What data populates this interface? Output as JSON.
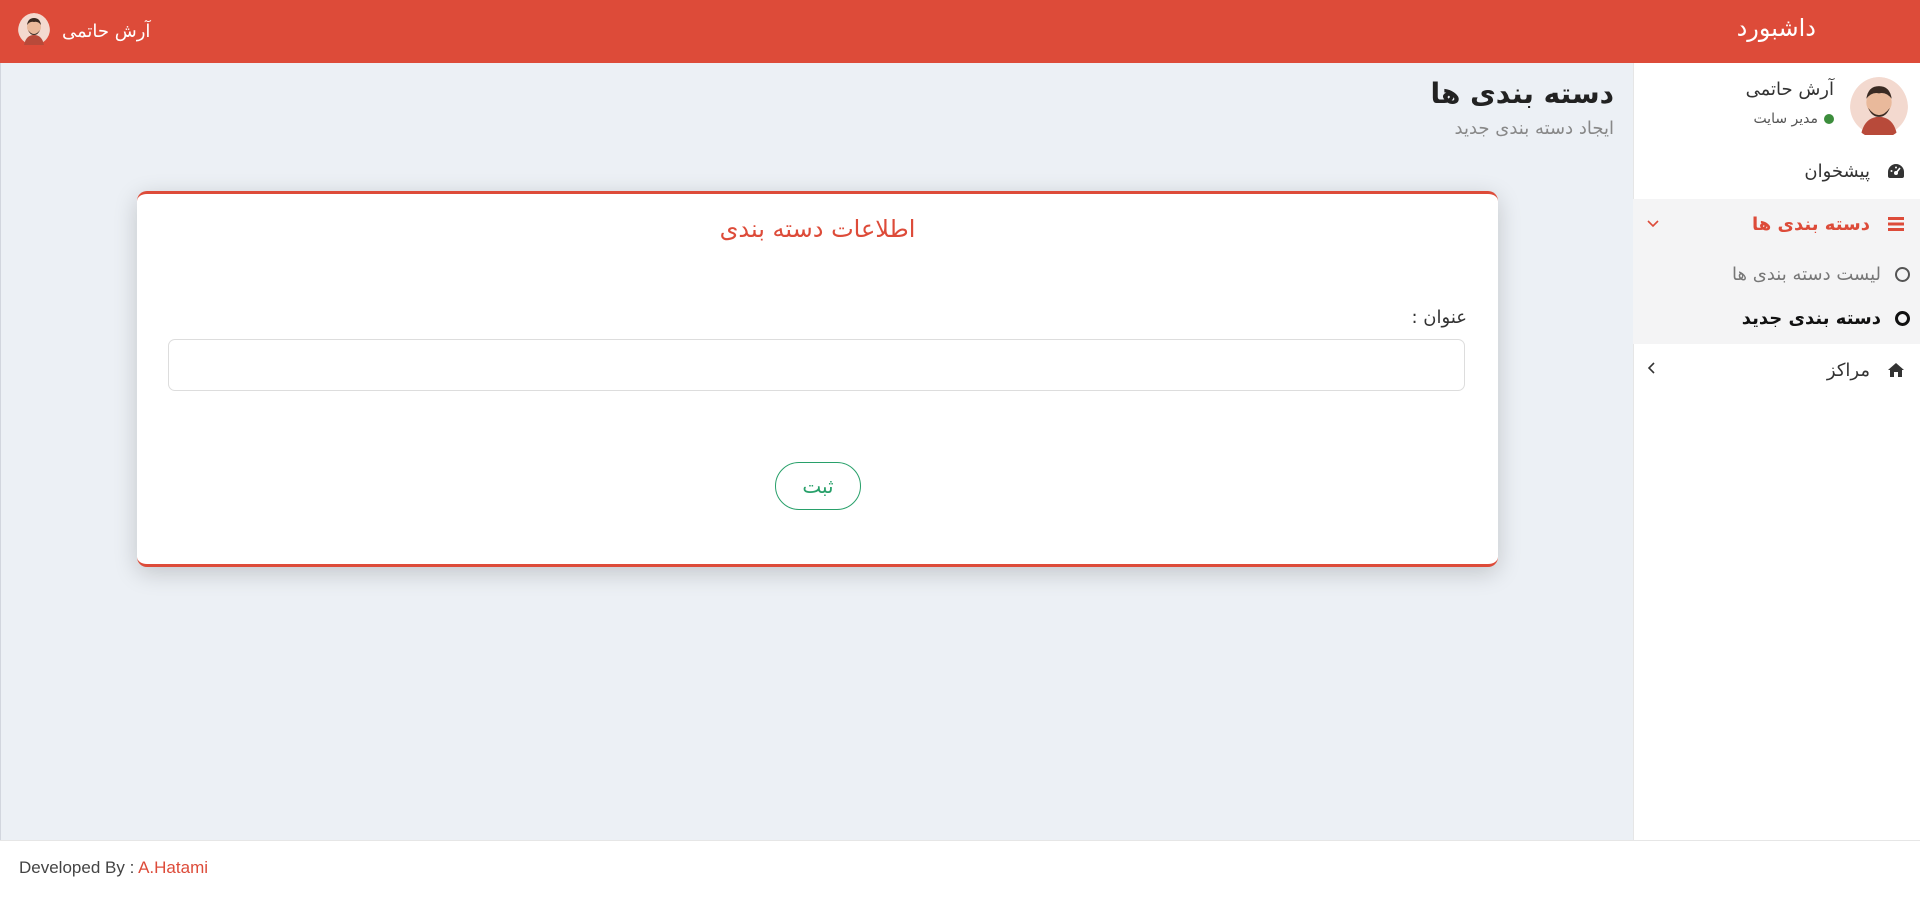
{
  "header": {
    "brand": "داشبورد",
    "user_name": "آرش حاتمی"
  },
  "sidebar": {
    "user_name": "آرش حاتمی",
    "user_role": "مدیر سایت",
    "items": [
      {
        "label": "پیشخوان",
        "icon": "dashboard-icon"
      },
      {
        "label": "دسته بندی ها",
        "icon": "list-icon",
        "active": true,
        "children": [
          {
            "label": "لیست دسته بندی ها"
          },
          {
            "label": "دسته بندی جدید",
            "active": true
          }
        ]
      },
      {
        "label": "مراکز",
        "icon": "home-icon"
      }
    ]
  },
  "main": {
    "title": "دسته بندی ها",
    "subtitle": "ایجاد دسته بندی جدید",
    "card": {
      "title": "اطلاعات دسته بندی",
      "field_label": "عنوان :",
      "field_value": "",
      "submit_label": "ثبت"
    }
  },
  "footer": {
    "prefix": "Developed By :",
    "author": "A.Hatami"
  },
  "colors": {
    "accent": "#dd4b39",
    "success": "#28a06a",
    "content_bg": "#ecf0f5",
    "online": "#3c8d3c"
  }
}
